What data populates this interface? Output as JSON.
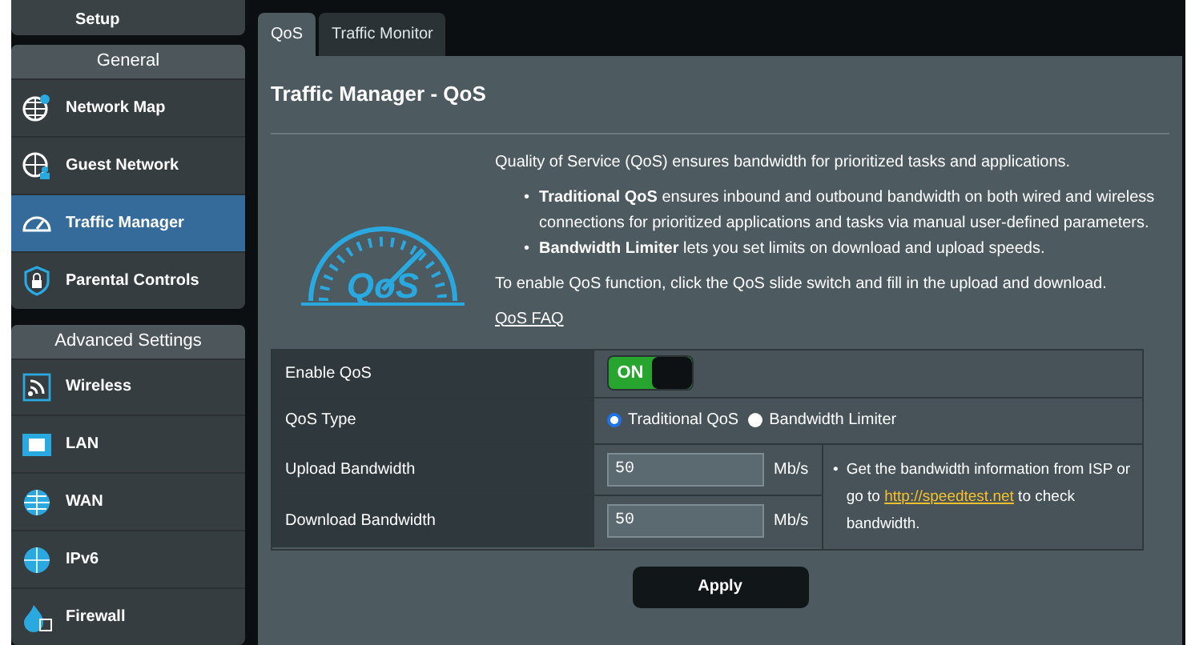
{
  "sidebar": {
    "top_item": {
      "label": "Setup"
    },
    "sections": [
      {
        "title": "General",
        "items": [
          {
            "label": "Network Map",
            "selected": false
          },
          {
            "label": "Guest Network",
            "selected": false
          },
          {
            "label": "Traffic Manager",
            "selected": true
          },
          {
            "label": "Parental Controls",
            "selected": false
          }
        ]
      },
      {
        "title": "Advanced Settings",
        "items": [
          {
            "label": "Wireless",
            "selected": false
          },
          {
            "label": "LAN",
            "selected": false
          },
          {
            "label": "WAN",
            "selected": false
          },
          {
            "label": "IPv6",
            "selected": false
          },
          {
            "label": "Firewall",
            "selected": false
          }
        ]
      }
    ]
  },
  "tabs": [
    {
      "label": "QoS",
      "selected": true
    },
    {
      "label": "Traffic Monitor",
      "selected": false
    }
  ],
  "page_title": "Traffic Manager - QoS",
  "logo_text": "QoS",
  "intro": "Quality of Service (QoS) ensures bandwidth for prioritized tasks and applications.",
  "bullets": [
    {
      "marker": "•",
      "text": "**Traditional QoS** ensures inbound and outbound bandwidth on both wired and wireless connections for prioritized applications and tasks via manual user-defined parameters."
    },
    {
      "marker": "•",
      "text": "**Bandwidth Limiter** lets you set limits on download and upload speeds."
    }
  ],
  "instruction": "To enable QoS function, click the QoS slide switch and fill in the upload and download.",
  "faq_link": "QoS FAQ",
  "settings": {
    "enable_qos": {
      "label": "Enable QoS",
      "on": true,
      "text": "ON"
    },
    "qos_type": {
      "label": "QoS Type",
      "options": [
        {
          "label": "Traditional QoS",
          "selected": true
        },
        {
          "label": "Bandwidth Limiter",
          "selected": false
        }
      ]
    },
    "bandwidth": [
      {
        "label": "Upload Bandwidth",
        "value": "50",
        "unit": "Mb/s"
      },
      {
        "label": "Download Bandwidth",
        "value": "50",
        "unit": "Mb/s"
      }
    ],
    "note": {
      "marker": "•",
      "before": "Get the bandwidth information from ISP or go to",
      "link": "http://speedtest.net",
      "after": "to check bandwidth."
    }
  },
  "apply_button": "Apply"
}
